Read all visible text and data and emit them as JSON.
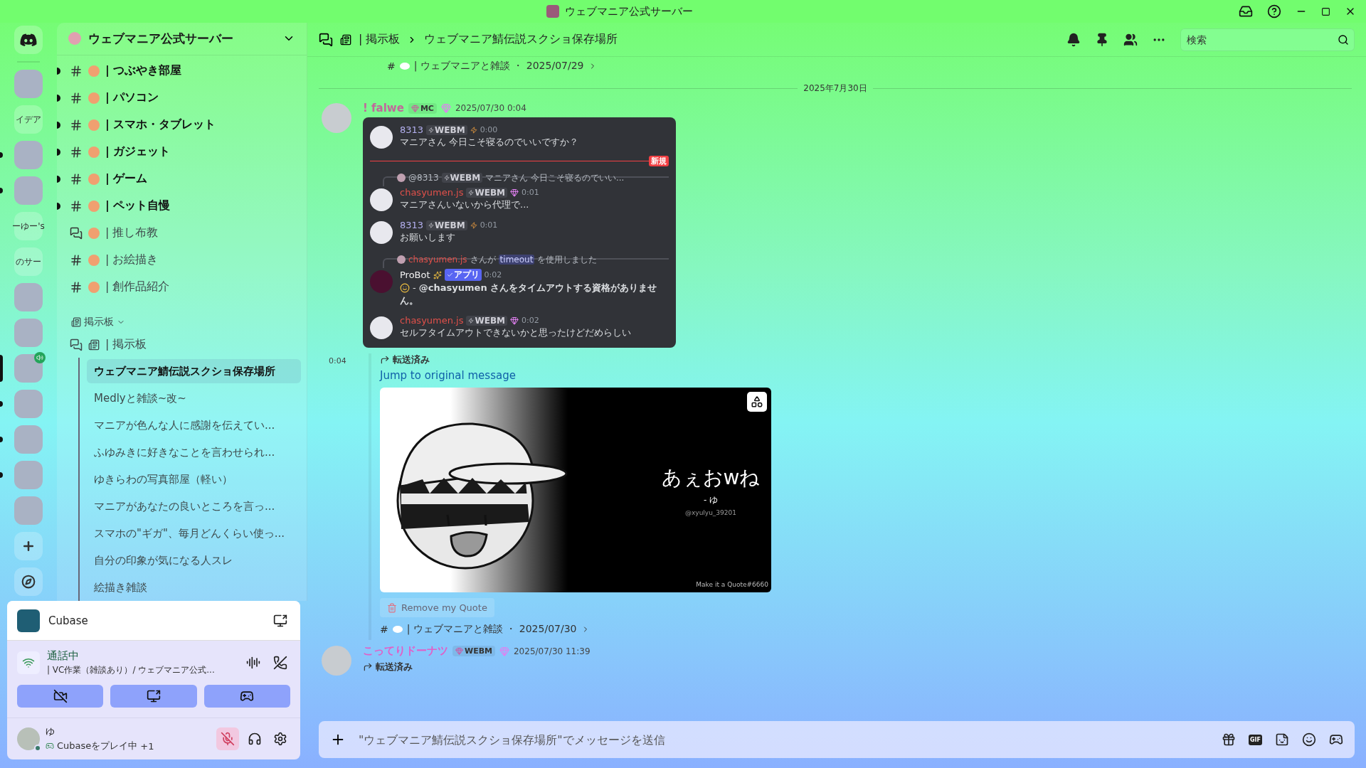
{
  "window": {
    "title": "ウェブマニア公式サーバー"
  },
  "servers": [
    {
      "kind": "home",
      "unread": false,
      "selected": false,
      "in_voice": false
    },
    {
      "kind": "image",
      "unread": false,
      "selected": false,
      "in_voice": false
    },
    {
      "kind": "text",
      "label": "イデア",
      "unread": false,
      "selected": false,
      "in_voice": false
    },
    {
      "kind": "image",
      "unread": true,
      "selected": false,
      "in_voice": false
    },
    {
      "kind": "image",
      "unread": true,
      "selected": false,
      "in_voice": false
    },
    {
      "kind": "text",
      "label": "ーゆー's",
      "unread": false,
      "selected": false,
      "in_voice": false
    },
    {
      "kind": "text",
      "label": "のサー",
      "unread": false,
      "selected": false,
      "in_voice": false
    },
    {
      "kind": "image",
      "unread": false,
      "selected": false,
      "in_voice": false
    },
    {
      "kind": "image",
      "unread": false,
      "selected": false,
      "in_voice": false
    },
    {
      "kind": "image",
      "unread": false,
      "selected": true,
      "in_voice": true
    },
    {
      "kind": "image",
      "unread": true,
      "selected": false,
      "in_voice": false
    },
    {
      "kind": "image",
      "unread": true,
      "selected": false,
      "in_voice": false
    },
    {
      "kind": "image",
      "unread": true,
      "selected": false,
      "in_voice": false
    },
    {
      "kind": "image",
      "unread": false,
      "selected": false,
      "in_voice": false
    },
    {
      "kind": "add",
      "unread": false,
      "selected": false,
      "in_voice": false
    },
    {
      "kind": "discover",
      "unread": false,
      "selected": false,
      "in_voice": false
    }
  ],
  "server": {
    "name": "ウェブマニア公式サーバー"
  },
  "channels": [
    {
      "kind": "text",
      "name": "| つぶやき部屋",
      "unread": true
    },
    {
      "kind": "text",
      "name": "| パソコン",
      "unread": true
    },
    {
      "kind": "text",
      "name": "| スマホ・タブレット",
      "unread": true
    },
    {
      "kind": "text",
      "name": "| ガジェット",
      "unread": true
    },
    {
      "kind": "text",
      "name": "| ゲーム",
      "unread": true
    },
    {
      "kind": "text",
      "name": "| ペット自慢",
      "unread": true
    },
    {
      "kind": "forum",
      "name": "| 推し布教",
      "unread": false
    },
    {
      "kind": "text",
      "name": "| お絵描き",
      "unread": false
    },
    {
      "kind": "text",
      "name": "| 創作品紹介",
      "unread": false
    }
  ],
  "category": {
    "name": "掲示板",
    "expanded": true,
    "forum": {
      "name": "| 掲示板",
      "children": [
        {
          "name": "ウェブマニア鯖伝説スクショ保存場所",
          "selected": true
        },
        {
          "name": "Medlyと雑談~改~",
          "selected": false
        },
        {
          "name": "マニアが色んな人に感謝を伝えてい...",
          "selected": false
        },
        {
          "name": "ふゆみきに好きなことを言わせられ...",
          "selected": false
        },
        {
          "name": "ゆきらわの写真部屋（軽い）",
          "selected": false
        },
        {
          "name": "マニアがあなたの良いところを言っ...",
          "selected": false
        },
        {
          "name": "スマホの\"ギガ\"、毎月どんくらい使っ...",
          "selected": false
        },
        {
          "name": "自分の印象が気になる人スレ",
          "selected": false
        },
        {
          "name": "絵描き雑談",
          "selected": false
        }
      ]
    }
  },
  "activity": {
    "name": "Cubase"
  },
  "voice": {
    "status": "通話中",
    "channel": "| VC作業（雑談あり）/ ウェブマニア公式..."
  },
  "user": {
    "name": "ゆ",
    "activity": "Cubaseをプレイ中",
    "extra": "+1",
    "muted": true
  },
  "header": {
    "parent": "| 掲示板",
    "title": "ウェブマニア鯖伝説スクショ保存場所",
    "search": {
      "placeholder": "検索"
    }
  },
  "feed": [
    {
      "kind": "source",
      "hash": "#",
      "channel": "| ウェブマニアと雑談 ・ 2025/07/29"
    },
    {
      "kind": "divider",
      "label": "2025年7月30日"
    },
    {
      "kind": "message",
      "author": "! falwe",
      "color": "#c0689a",
      "tag": "MC",
      "timestamp": "2025/07/30 0:04",
      "screenshot": {
        "items": [
          {
            "kind": "post",
            "author": "8313",
            "color": "#b4b0f0",
            "tag": "WEBM",
            "stripe": true,
            "gem": false,
            "bot": false,
            "time": "0:00",
            "text": "マニアさん 今日こそ寝るのでいいですか？"
          },
          {
            "kind": "divider",
            "label": "新規"
          },
          {
            "kind": "post",
            "reply": {
              "mention": "@8313",
              "tag": "WEBM",
              "text": "マニアさん 今日こそ寝るのでいい..."
            },
            "author": "chasyumen.js",
            "color": "#e0504a",
            "tag": "WEBM",
            "stripe": false,
            "gem": true,
            "bot": false,
            "time": "0:01",
            "text": "マニアさんいないから代理で..."
          },
          {
            "kind": "post",
            "author": "8313",
            "color": "#b4b0f0",
            "tag": "WEBM",
            "stripe": true,
            "gem": false,
            "bot": false,
            "time": "0:01",
            "text": "お願いします"
          },
          {
            "kind": "post",
            "command": {
              "user": "chasyumen.js",
              "before": "さんが",
              "name": "timeout",
              "after": "を使用しました"
            },
            "author": "ProBot",
            "color": "#f2f2f2",
            "tag": "アプリ",
            "bot": true,
            "time": "0:02",
            "text": "- **@chasyumen さんをタイムアウトする資格がありません。**"
          },
          {
            "kind": "post",
            "author": "chasyumen.js",
            "color": "#e0504a",
            "tag": "WEBM",
            "stripe": false,
            "gem": true,
            "bot": false,
            "time": "0:02",
            "text": "セルフタイムアウトできないかと思ったけどだめらしい"
          }
        ]
      }
    },
    {
      "kind": "forward",
      "time": "0:04",
      "label": "転送済み",
      "link": "Jump to original message",
      "quote": {
        "text": "あぇおwね",
        "author": "- ゆ",
        "handle": "@xyulyu_39201",
        "credit": "Make it a Quote#6660"
      },
      "button": "Remove my Quote",
      "hash": "#",
      "channel": "| ウェブマニアと雑談 ・ 2025/07/30"
    },
    {
      "kind": "message",
      "author": "こってりドーナツ",
      "color": "#e060c8",
      "tag": "WEBM",
      "timestamp": "2025/07/30 11:39",
      "forwarded": "転送済み"
    }
  ],
  "composer": {
    "placeholder": "\"ウェブマニア鯖伝説スクショ保存場所\"でメッセージを送信",
    "gif": "GIF"
  }
}
